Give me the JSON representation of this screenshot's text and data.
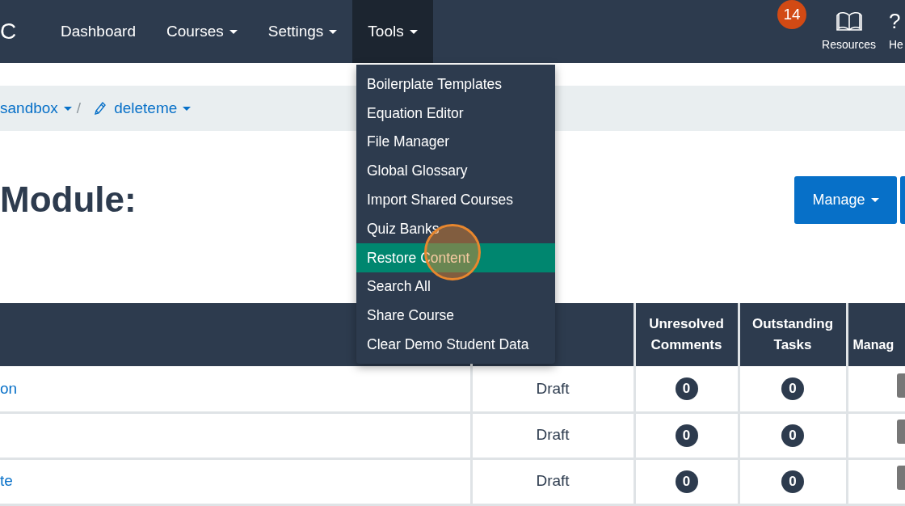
{
  "navbar": {
    "logo": "C",
    "items": [
      {
        "label": "Dashboard",
        "dropdown": false,
        "selected": false
      },
      {
        "label": "Courses",
        "dropdown": true,
        "selected": false
      },
      {
        "label": "Settings",
        "dropdown": true,
        "selected": false
      },
      {
        "label": "Tools",
        "dropdown": true,
        "selected": true
      }
    ],
    "resources": {
      "label": "Resources",
      "badge": "14"
    },
    "help": {
      "icon": "?",
      "label": "He"
    }
  },
  "breadcrumb": [
    {
      "label": "sandbox",
      "kind": "plain"
    },
    {
      "separator": "/",
      "label": "deleteme",
      "kind": "pencil"
    }
  ],
  "page_title": "Module:",
  "manage_button": "Manage",
  "tools_menu": [
    {
      "label": "Boilerplate Templates",
      "selected": false
    },
    {
      "label": "Equation Editor",
      "selected": false
    },
    {
      "label": "File Manager",
      "selected": false
    },
    {
      "label": "Global Glossary",
      "selected": false
    },
    {
      "label": "Import Shared Courses",
      "selected": false
    },
    {
      "label": "Quiz Banks",
      "selected": false
    },
    {
      "label": "Restore Content",
      "selected": true
    },
    {
      "label": "Search All",
      "selected": false
    },
    {
      "label": "Share Course",
      "selected": false
    },
    {
      "label": "Clear Demo Student Data",
      "selected": false
    }
  ],
  "table": {
    "columns": [
      {
        "kind": "blank"
      },
      {
        "kind": "blank"
      },
      {
        "kind": "text",
        "label": "Unresolved Comments"
      },
      {
        "kind": "text",
        "label": "Outstanding Tasks"
      },
      {
        "kind": "text",
        "label": "Manag"
      }
    ],
    "rows": [
      {
        "title": "on",
        "status": "Draft",
        "comments": "0",
        "tasks": "0"
      },
      {
        "status": "Draft",
        "comments": "0",
        "tasks": "0"
      },
      {
        "title": "te",
        "status": "Draft",
        "comments": "0",
        "tasks": "0"
      }
    ]
  }
}
